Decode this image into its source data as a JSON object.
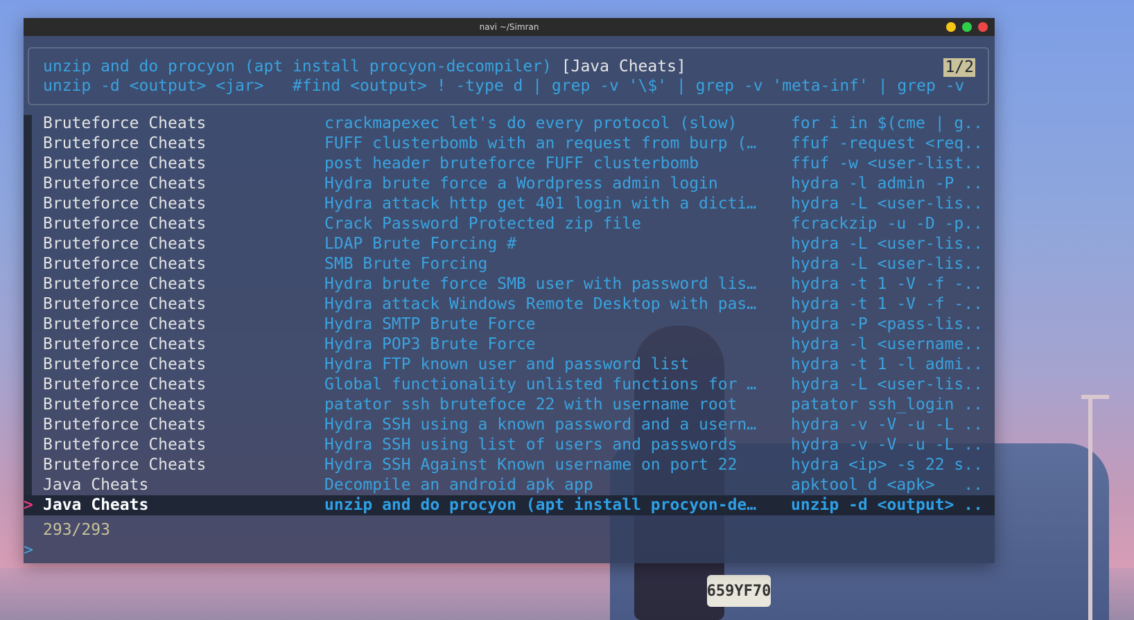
{
  "window": {
    "title": "navi ~/Simran"
  },
  "preview": {
    "line1_description": "unzip and do procyon (apt install procyon-decompiler)",
    "line1_tag": "[Java Cheats]",
    "line2_command": "unzip -d <output> <jar>   #find <output> ! -type d | grep -v '\\$' | grep -v 'meta-inf' | grep -v",
    "page_indicator": "1/2"
  },
  "list": {
    "pointer": ">",
    "rows": [
      {
        "tag": "Bruteforce Cheats",
        "description": "crackmapexec let's do every protocol (slow)",
        "command": "for i in $(cme | g.."
      },
      {
        "tag": "Bruteforce Cheats",
        "description": "FUFF clusterbomb with an request from burp (…",
        "command": "ffuf -request <req.."
      },
      {
        "tag": "Bruteforce Cheats",
        "description": "post header bruteforce FUFF clusterbomb",
        "command": "ffuf -w <user-list.."
      },
      {
        "tag": "Bruteforce Cheats",
        "description": "Hydra brute force a Wordpress admin login",
        "command": "hydra -l admin -P .."
      },
      {
        "tag": "Bruteforce Cheats",
        "description": "Hydra attack http get 401 login with a dicti…",
        "command": "hydra -L <user-lis.."
      },
      {
        "tag": "Bruteforce Cheats",
        "description": "Crack Password Protected zip file",
        "command": "fcrackzip -u -D -p.."
      },
      {
        "tag": "Bruteforce Cheats",
        "description": "LDAP Brute Forcing #",
        "command": "hydra -L <user-lis.."
      },
      {
        "tag": "Bruteforce Cheats",
        "description": "SMB Brute Forcing",
        "command": "hydra -L <user-lis.."
      },
      {
        "tag": "Bruteforce Cheats",
        "description": "Hydra brute force SMB user with password lis…",
        "command": "hydra -t 1 -V -f -.."
      },
      {
        "tag": "Bruteforce Cheats",
        "description": "Hydra attack Windows Remote Desktop with pas…",
        "command": "hydra -t 1 -V -f -.."
      },
      {
        "tag": "Bruteforce Cheats",
        "description": "Hydra SMTP Brute Force",
        "command": "hydra -P <pass-lis.."
      },
      {
        "tag": "Bruteforce Cheats",
        "description": "Hydra POP3 Brute Force",
        "command": "hydra -l <username.."
      },
      {
        "tag": "Bruteforce Cheats",
        "description": "Hydra FTP known user and password list",
        "command": "hydra -t 1 -l admi.."
      },
      {
        "tag": "Bruteforce Cheats",
        "description": "Global functionality unlisted functions for …",
        "command": "hydra -L <user-lis.."
      },
      {
        "tag": "Bruteforce Cheats",
        "description": "patator ssh brutefoce 22 with username root",
        "command": "patator ssh_login .."
      },
      {
        "tag": "Bruteforce Cheats",
        "description": "Hydra SSH using a known password and a usern…",
        "command": "hydra -v -V -u -L .."
      },
      {
        "tag": "Bruteforce Cheats",
        "description": "Hydra SSH using list of users and passwords",
        "command": "hydra -v -V -u -L .."
      },
      {
        "tag": "Bruteforce Cheats",
        "description": "Hydra SSH Against Known username on port 22",
        "command": "hydra <ip> -s 22 s.."
      },
      {
        "tag": "Java Cheats",
        "description": "Decompile an android apk app",
        "command": "apktool d <apk>   .."
      },
      {
        "tag": "Java Cheats",
        "description": "unzip and do procyon (apt install procyon-de…",
        "command": "unzip -d <output> ..",
        "selected": true
      }
    ]
  },
  "status": {
    "count": "293/293"
  },
  "prompt": {
    "symbol": ">"
  },
  "background": {
    "plate_text": "659YF70"
  },
  "colors": {
    "cyan": "#39a3df",
    "selected_bg": "#1f2636",
    "pointer": "#e03a7a",
    "count": "#c9c29a",
    "min_button": "#f5c518",
    "max_button": "#2fcf4a",
    "close_button": "#ed4647"
  }
}
